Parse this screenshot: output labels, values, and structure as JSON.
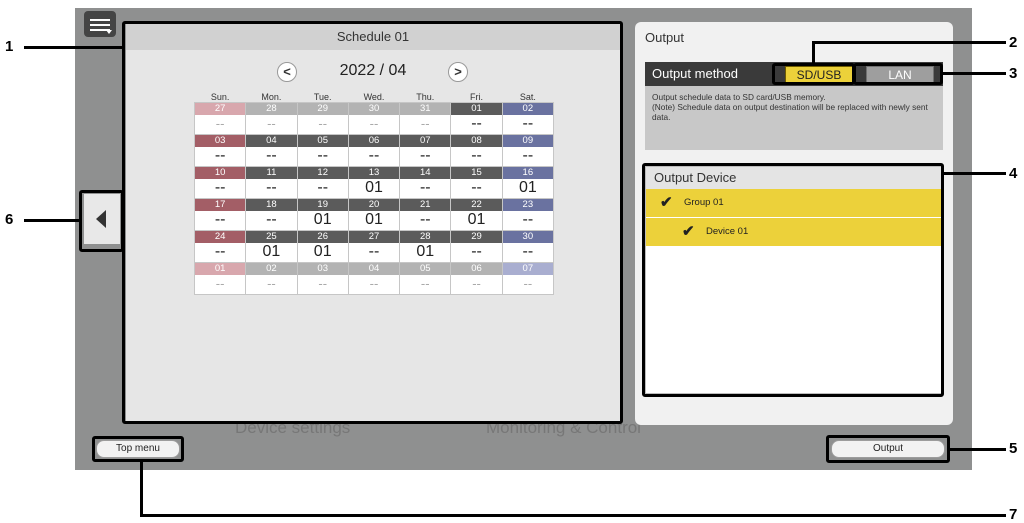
{
  "schedule": {
    "title": "Schedule 01",
    "prev_icon": "chevron-left-icon",
    "next_icon": "chevron-right-icon",
    "prev_glyph": "<",
    "next_glyph": ">",
    "month": "2022 / 04",
    "weekdays": [
      "Sun.",
      "Mon.",
      "Tue.",
      "Wed.",
      "Thu.",
      "Fri.",
      "Sat."
    ],
    "weeks": [
      {
        "days": [
          "27",
          "28",
          "29",
          "30",
          "31",
          "01",
          "02"
        ],
        "values": [
          "--",
          "--",
          "--",
          "--",
          "--",
          "--",
          "--"
        ],
        "in_month": [
          false,
          false,
          false,
          false,
          false,
          true,
          true
        ]
      },
      {
        "days": [
          "03",
          "04",
          "05",
          "06",
          "07",
          "08",
          "09"
        ],
        "values": [
          "--",
          "--",
          "--",
          "--",
          "--",
          "--",
          "--"
        ],
        "in_month": [
          true,
          true,
          true,
          true,
          true,
          true,
          true
        ]
      },
      {
        "days": [
          "10",
          "11",
          "12",
          "13",
          "14",
          "15",
          "16"
        ],
        "values": [
          "--",
          "--",
          "--",
          "01",
          "--",
          "--",
          "01"
        ],
        "in_month": [
          true,
          true,
          true,
          true,
          true,
          true,
          true
        ]
      },
      {
        "days": [
          "17",
          "18",
          "19",
          "20",
          "21",
          "22",
          "23"
        ],
        "values": [
          "--",
          "--",
          "01",
          "01",
          "--",
          "01",
          "--"
        ],
        "in_month": [
          true,
          true,
          true,
          true,
          true,
          true,
          true
        ]
      },
      {
        "days": [
          "24",
          "25",
          "26",
          "27",
          "28",
          "29",
          "30"
        ],
        "values": [
          "--",
          "01",
          "01",
          "--",
          "01",
          "--",
          "--"
        ],
        "in_month": [
          true,
          true,
          true,
          true,
          true,
          true,
          true
        ]
      },
      {
        "days": [
          "01",
          "02",
          "03",
          "04",
          "05",
          "06",
          "07"
        ],
        "values": [
          "--",
          "--",
          "--",
          "--",
          "--",
          "--",
          "--"
        ],
        "in_month": [
          false,
          false,
          false,
          false,
          false,
          false,
          false
        ]
      }
    ],
    "colors": {
      "sun": "#a35e66",
      "sat": "#6a72a0",
      "weekday": "#5b5b5b",
      "sun_dim": "#d8a7ad",
      "sat_dim": "#a9aed0",
      "weekday_dim": "#b3b3b3"
    }
  },
  "output": {
    "title": "Output",
    "method_label": "Output method",
    "sd_usb": "SD/USB",
    "lan": "LAN",
    "description": "Output schedule data to SD card/USB memory.\n(Note) Schedule data on output destination will be replaced with newly sent data.",
    "device_title": "Output Device",
    "devices": [
      {
        "name": "Group 01",
        "checked": true,
        "indent": 0
      },
      {
        "name": "Device 01",
        "checked": true,
        "indent": 1
      }
    ],
    "accent": "#ecd13a",
    "check_glyph": "✔"
  },
  "buttons": {
    "top_menu": "Top menu",
    "output": "Output"
  },
  "background": {
    "ghost_device_settings": "Device settings",
    "ghost_monitoring": "Monitoring & Control"
  },
  "callouts": [
    "1",
    "2",
    "3",
    "4",
    "5",
    "6",
    "7"
  ]
}
